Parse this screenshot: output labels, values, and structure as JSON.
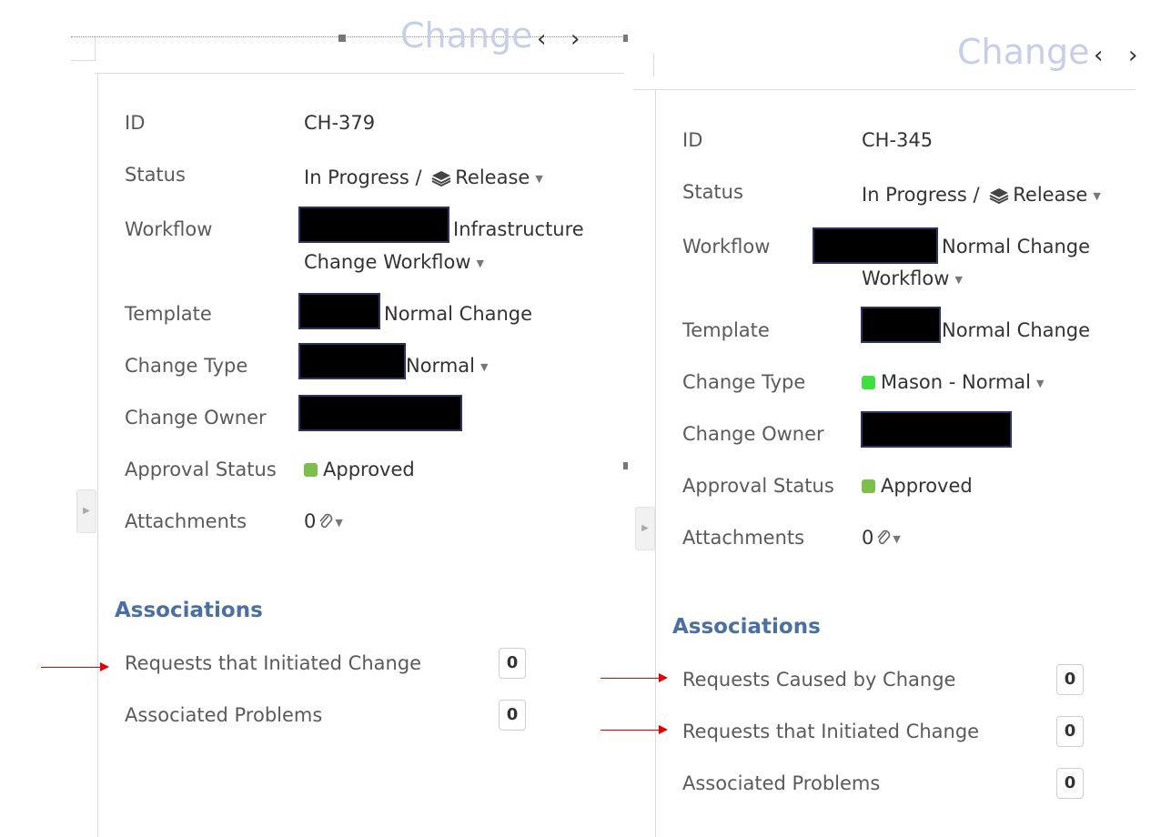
{
  "left_panel": {
    "header_title": "Change",
    "fields": {
      "id": {
        "label": "ID",
        "value": "CH-379"
      },
      "status": {
        "label": "Status",
        "state": "In Progress /",
        "phase": "Release"
      },
      "workflow": {
        "label": "Workflow",
        "value_line1": "Infrastructure",
        "value_line2": "Change Workflow"
      },
      "template": {
        "label": "Template",
        "value": "Normal Change"
      },
      "change_type": {
        "label": "Change Type",
        "value": "Normal"
      },
      "change_owner": {
        "label": "Change Owner"
      },
      "approval_status": {
        "label": "Approval Status",
        "value": "Approved"
      },
      "attachments": {
        "label": "Attachments",
        "value": "0"
      }
    },
    "associations": {
      "heading": "Associations",
      "items": [
        {
          "label": "Requests that Initiated Change",
          "count": "0"
        },
        {
          "label": "Associated Problems",
          "count": "0"
        }
      ]
    }
  },
  "right_panel": {
    "header_title": "Change",
    "fields": {
      "id": {
        "label": "ID",
        "value": "CH-345"
      },
      "status": {
        "label": "Status",
        "state": "In Progress /",
        "phase": "Release"
      },
      "workflow": {
        "label": "Workflow",
        "value_line1": "Normal Change",
        "value_line2": "Workflow"
      },
      "template": {
        "label": "Template",
        "value": "Normal Change"
      },
      "change_type": {
        "label": "Change Type",
        "value": "Mason - Normal"
      },
      "change_owner": {
        "label": "Change Owner"
      },
      "approval_status": {
        "label": "Approval Status",
        "value": "Approved"
      },
      "attachments": {
        "label": "Attachments",
        "value": "0"
      }
    },
    "associations": {
      "heading": "Associations",
      "items": [
        {
          "label": "Requests Caused by Change",
          "count": "0"
        },
        {
          "label": "Requests that Initiated Change",
          "count": "0"
        },
        {
          "label": "Associated Problems",
          "count": "0"
        }
      ]
    }
  },
  "colors": {
    "approved_dot": "#7cc04b",
    "change_type_dot": "#3ee03e",
    "associations_heading": "#4a6fa5",
    "annotation_arrow": "#e00000"
  }
}
